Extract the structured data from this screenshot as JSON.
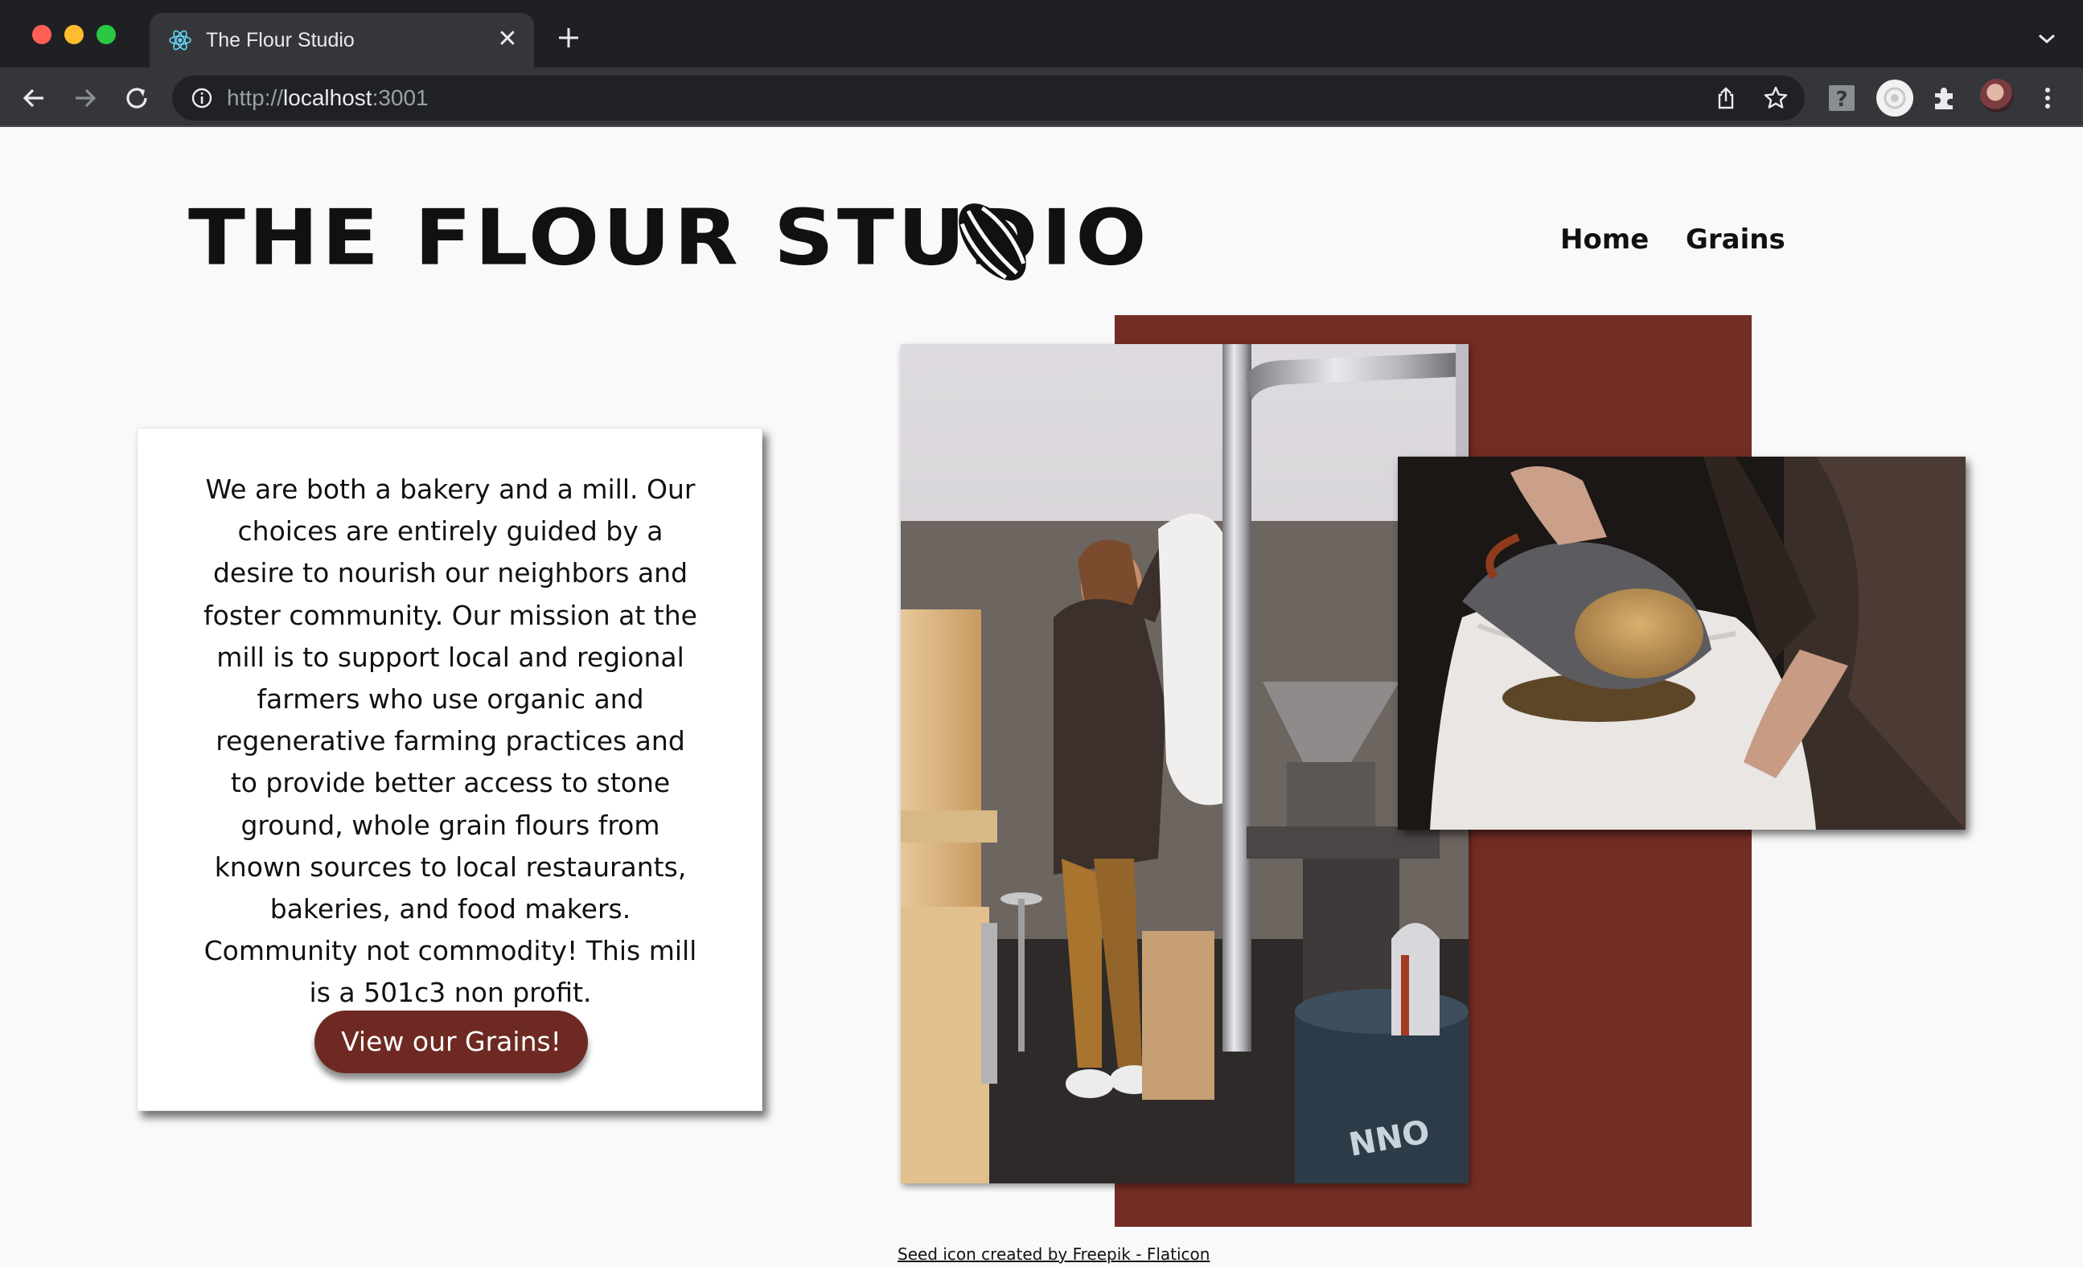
{
  "browser": {
    "tab_title": "The Flour Studio",
    "tab_close": "✕",
    "url_scheme": "http://",
    "url_host": "localhost",
    "url_port": ":3001",
    "icons": [
      "react-favicon",
      "new-tab-icon",
      "tab-menu-chevron-icon",
      "back-arrow-icon",
      "forward-arrow-icon",
      "reload-icon",
      "site-info-icon",
      "share-icon",
      "bookmark-star-icon",
      "extension-help-icon",
      "extension-circle-icon",
      "puzzle-extensions-icon",
      "profile-avatar",
      "more-menu-icon"
    ]
  },
  "site": {
    "title": "THE FLOUR STUDIO",
    "logo_icon": "seed-icon",
    "nav": {
      "home": "Home",
      "grains": "Grains"
    }
  },
  "about": {
    "text": "We are both a bakery and a mill. Our choices are entirely guided by a desire to nourish our neighbors and foster community. Our mission at the mill is to support local and regional farmers who use organic and regenerative farming practices and to provide better access to stone ground, whole grain flours from known sources to local restaurants, bakeries, and food makers. Community not commodity! This mill is a 501c3 non profit.",
    "button_label": "View our Grains!"
  },
  "gallery": {
    "photo_mill_label": "",
    "photo_grain_label": ""
  },
  "footer": {
    "credit": "Seed icon created by Freepik - Flaticon"
  },
  "colors": {
    "accent": "#732d24",
    "button": "#6e2a22",
    "page_bg": "#f9f9f9",
    "chrome_bg": "#1f2023",
    "toolbar_bg": "#35363a"
  }
}
